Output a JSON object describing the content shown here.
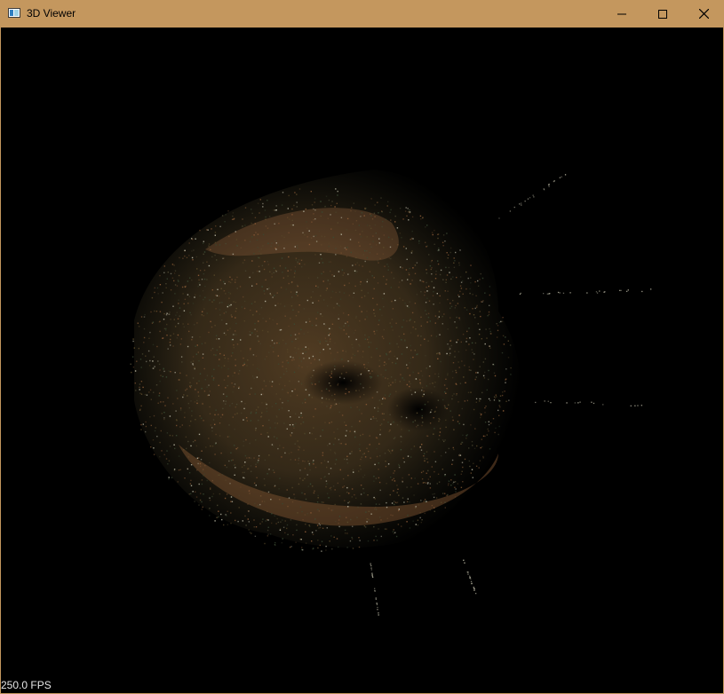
{
  "window": {
    "title": "3D Viewer",
    "frame_color": "#c4975e",
    "controls": {
      "minimize_icon": "minimize-icon",
      "maximize_icon": "maximize-icon",
      "close_icon": "close-icon"
    }
  },
  "viewport": {
    "background": "#000000",
    "fps_label": "250.0 FPS",
    "point_cloud_colors": [
      "#6b4a2c",
      "#8a5a36",
      "#4a4630",
      "#3a4a33",
      "#b9b6a2",
      "#5a4a2a"
    ]
  }
}
